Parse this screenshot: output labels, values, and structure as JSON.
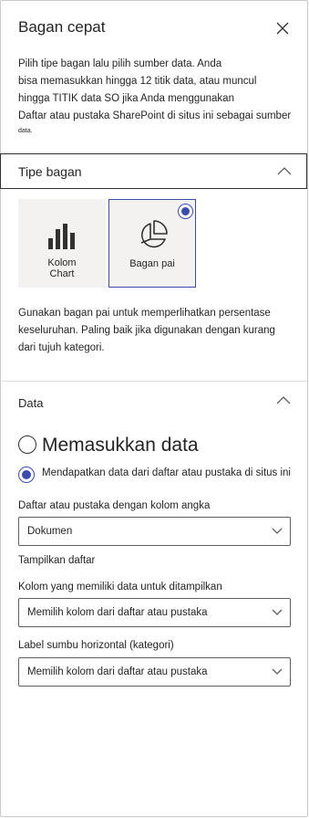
{
  "panel": {
    "title": "Bagan cepat",
    "intro_lines": [
      "Pilih tipe bagan lalu pilih sumber data. Anda",
      "bisa memasukkan hingga 12 titik data, atau muncul",
      "hingga TITIK data SO jika Anda menggunakan",
      "Daftar atau pustaka SharePoint di situs ini sebagai sumber",
      "data."
    ]
  },
  "chart_type_section": {
    "label": "Tipe bagan",
    "tiles": [
      {
        "label_line1": "Kolom",
        "label_line2": "Chart",
        "icon": "column-chart-icon",
        "selected": false
      },
      {
        "label_line1": "Bagan pai",
        "icon": "pie-chart-icon",
        "selected": true
      }
    ],
    "description_lines": [
      "Gunakan bagan pai untuk memperlihatkan persentase",
      "keseluruhan. Paling baik jika digunakan dengan kurang",
      "dari tujuh kategori."
    ]
  },
  "data_section": {
    "label": "Data",
    "option_enter": "Memasukkan data",
    "option_list": "Mendapatkan data dari daftar atau pustaka di situs ini",
    "list_label": "Daftar atau pustaka dengan kolom angka",
    "list_value": "Dokumen",
    "show_list": "Tampilkan daftar",
    "column_label": "Kolom yang memiliki data untuk ditampilkan",
    "column_value": "Memilih kolom dari daftar atau pustaka",
    "axis_label": "Label sumbu horizontal (kategori)",
    "axis_value": "Memilih kolom dari daftar atau pustaka"
  },
  "colors": {
    "accent": "#3a4cb0",
    "text": "#252423",
    "border": "#605e5c",
    "tile_bg": "#f3f2f1"
  }
}
